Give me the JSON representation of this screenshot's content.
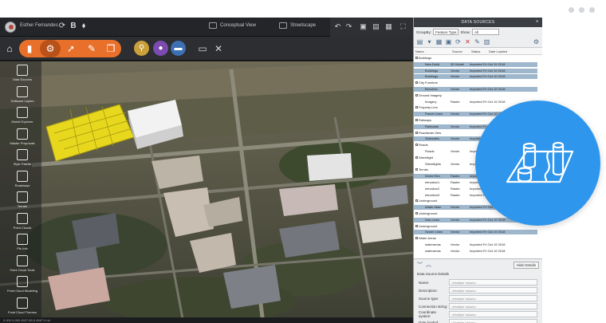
{
  "titlebar": {
    "user_name": "Esther Fernandes",
    "mode_conceptual": "Conceptual View",
    "mode_streetscape": "Streetscape"
  },
  "sidebar": {
    "items": [
      {
        "label": "Data Sources",
        "icon": "data-sources-icon"
      },
      {
        "label": "Software Layers",
        "icon": "layers-icon"
      },
      {
        "label": "Model Explorer",
        "icon": "model-explorer-icon"
      },
      {
        "label": "Master Proposals",
        "icon": "proposals-icon"
      },
      {
        "label": "Style Palette",
        "icon": "style-palette-icon"
      },
      {
        "label": "Roadways",
        "icon": "roadways-icon"
      },
      {
        "label": "Terrain",
        "icon": "terrain-icon"
      },
      {
        "label": "Point Clouds",
        "icon": "point-clouds-icon"
      },
      {
        "label": "Pts Info",
        "icon": "info-icon"
      },
      {
        "label": "Point Cloud Tools",
        "icon": "point-cloud-tools-icon"
      },
      {
        "label": "Point Cloud Modeling",
        "icon": "modeling-icon"
      },
      {
        "label": "Point Cloud Themes",
        "icon": "themes-icon"
      }
    ]
  },
  "status": {
    "coords": "0.000  0.000  4527.85,5 4567.4 mi"
  },
  "panel": {
    "title": "DATA SOURCES",
    "groupby_label": "GroupBy:",
    "groupby_value": "Feature Type",
    "show_label": "Show:",
    "show_value": "All",
    "columns": [
      "Name",
      "Source Type",
      "Status",
      "Date Loaded"
    ],
    "rows": [
      {
        "kind": "group",
        "name": "Buildings",
        "type": "",
        "status": "",
        "sel": false
      },
      {
        "kind": "child",
        "name": "New Build",
        "type": "3D Model",
        "status": "Imported Fri Oct 19 2018",
        "sel": true
      },
      {
        "kind": "child",
        "name": "Buildings",
        "type": "Vector",
        "status": "Imported Fri Oct 19 2018",
        "sel": true
      },
      {
        "kind": "child",
        "name": "Buildings",
        "type": "Vector",
        "status": "Imported Fri Oct 19 2018",
        "sel": true
      },
      {
        "kind": "group",
        "name": "City Furniture",
        "type": "",
        "status": "",
        "sel": false
      },
      {
        "kind": "child",
        "name": "Benches",
        "type": "Vector",
        "status": "Imported Fri Oct 19 2018",
        "sel": true
      },
      {
        "kind": "group",
        "name": "Ground Imagery",
        "type": "",
        "status": "",
        "sel": false
      },
      {
        "kind": "child",
        "name": "Imagery",
        "type": "Raster",
        "status": "Imported Fri Oct 19 2018",
        "sel": false
      },
      {
        "kind": "group",
        "name": "Property Line",
        "type": "",
        "status": "",
        "sel": false
      },
      {
        "kind": "child",
        "name": "Parcel Lines",
        "type": "Vector",
        "status": "Imported Fri Oct 19 2018",
        "sel": true
      },
      {
        "kind": "group",
        "name": "Railways",
        "type": "",
        "status": "",
        "sel": false
      },
      {
        "kind": "child",
        "name": "Railroads",
        "type": "Vector",
        "status": "Imported Fri Oct 19 2018",
        "sel": true
      },
      {
        "kind": "group",
        "name": "Roadlands Sets",
        "type": "",
        "status": "",
        "sel": false
      },
      {
        "kind": "child",
        "name": "Sidewalks",
        "type": "Vector",
        "status": "Imported Fri Oct 19 2018",
        "sel": true
      },
      {
        "kind": "group",
        "name": "Roads",
        "type": "",
        "status": "",
        "sel": false
      },
      {
        "kind": "child",
        "name": "Roads",
        "type": "Vector",
        "status": "Imported Fri Oct 19 2018",
        "sel": false
      },
      {
        "kind": "group",
        "name": "Streetlight",
        "type": "",
        "status": "",
        "sel": false
      },
      {
        "kind": "child",
        "name": "Streetlights",
        "type": "Vector",
        "status": "Imported Fri Oct 19 2018",
        "sel": false
      },
      {
        "kind": "group",
        "name": "Terrain",
        "type": "",
        "status": "",
        "sel": false
      },
      {
        "kind": "child",
        "name": "World Elev",
        "type": "Raster",
        "status": "Imported Fri Oct 19 2018",
        "sel": true
      },
      {
        "kind": "child",
        "name": "elevation1",
        "type": "Raster",
        "status": "Imported Fri Oct 19 2018",
        "sel": false
      },
      {
        "kind": "child",
        "name": "elevation2",
        "type": "Raster",
        "status": "Imported Fri Oct 19 2018",
        "sel": false
      },
      {
        "kind": "child",
        "name": "elevation3",
        "type": "Raster",
        "status": "Imported Fri Oct 19 2018",
        "sel": false
      },
      {
        "kind": "group",
        "name": "Underground",
        "type": "",
        "status": "",
        "sel": false
      },
      {
        "kind": "child",
        "name": "Water Main",
        "type": "Vector",
        "status": "Imported Fri Oct 19 2018",
        "sel": true
      },
      {
        "kind": "group",
        "name": "Underground",
        "type": "",
        "status": "",
        "sel": false
      },
      {
        "kind": "child",
        "name": "Gas Lines",
        "type": "Vector",
        "status": "Imported Fri Oct 19 2018",
        "sel": true
      },
      {
        "kind": "group",
        "name": "Underground",
        "type": "",
        "status": "",
        "sel": false
      },
      {
        "kind": "child",
        "name": "Sewer Lines",
        "type": "Vector",
        "status": "Imported Fri Oct 19 2018",
        "sel": true
      },
      {
        "kind": "group",
        "name": "Water Areas",
        "type": "",
        "status": "",
        "sel": false
      },
      {
        "kind": "child",
        "name": "waterareas",
        "type": "Vector",
        "status": "Imported Fri Oct 19 2018",
        "sel": false
      },
      {
        "kind": "child",
        "name": "waterareas",
        "type": "Vector",
        "status": "Imported Fri Oct 19 2018",
        "sel": false
      }
    ],
    "hide_details": "Hide Details",
    "details_title": "Data Source Details",
    "details": [
      {
        "key": "Name:",
        "value": "<Multiple Values>"
      },
      {
        "key": "Description:",
        "value": "<Multiple Values>"
      },
      {
        "key": "Source type:",
        "value": "<Multiple Values>"
      },
      {
        "key": "Connection string:",
        "value": "<Multiple Values>"
      },
      {
        "key": "Coordinate system:",
        "value": "<Multiple Values>"
      },
      {
        "key": "Date loaded:",
        "value": "<Multiple Values>"
      }
    ]
  },
  "colors": {
    "accent": "#e8702a",
    "badge": "#2e96ec",
    "selection": "#9fb7cc"
  }
}
